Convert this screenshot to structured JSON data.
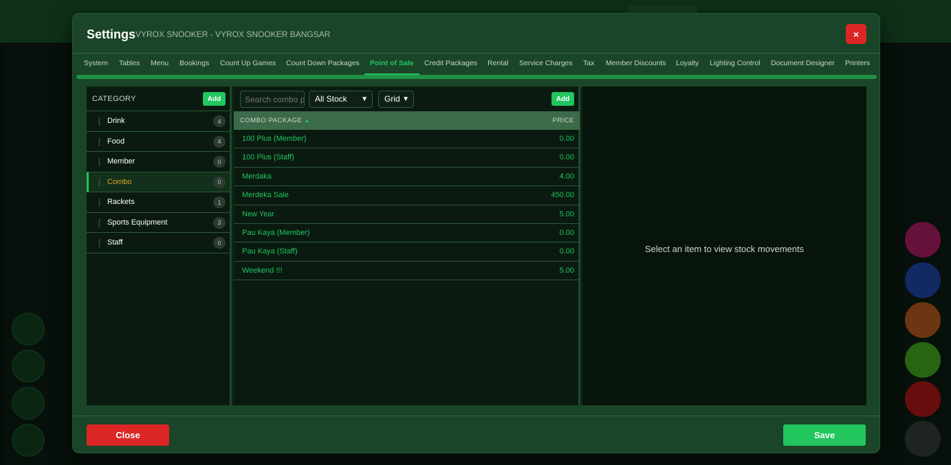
{
  "background": {
    "left_circles": 4,
    "right_circle_colors": [
      "#9d1a5c",
      "#1e3f9a",
      "#a8521c",
      "#3e9a1c",
      "#a01515",
      "#2f3a32"
    ]
  },
  "modal": {
    "title": "Settings",
    "subtitle": "VYROX SNOOKER - VYROX SNOOKER BANGSAR",
    "close_icon": "×"
  },
  "tabs": [
    {
      "label": "System"
    },
    {
      "label": "Tables"
    },
    {
      "label": "Menu"
    },
    {
      "label": "Bookings"
    },
    {
      "label": "Count Up Games"
    },
    {
      "label": "Count Down Packages"
    },
    {
      "label": "Point of Sale",
      "active": true
    },
    {
      "label": "Credit Packages"
    },
    {
      "label": "Rental"
    },
    {
      "label": "Service Charges"
    },
    {
      "label": "Tax"
    },
    {
      "label": "Member Discounts"
    },
    {
      "label": "Loyalty"
    },
    {
      "label": "Lighting Control"
    },
    {
      "label": "Document Designer"
    },
    {
      "label": "Printers"
    }
  ],
  "category": {
    "header": "CATEGORY",
    "add_label": "Add",
    "items": [
      {
        "name": "Drink",
        "count": "4"
      },
      {
        "name": "Food",
        "count": "4"
      },
      {
        "name": "Member",
        "count": "0"
      },
      {
        "name": "Combo",
        "count": "0",
        "active": true
      },
      {
        "name": "Rackets",
        "count": "1"
      },
      {
        "name": "Sports Equipment",
        "count": "3"
      },
      {
        "name": "Staff",
        "count": "0"
      }
    ]
  },
  "combo": {
    "search_placeholder": "Search combo p",
    "stock_filter": "All Stock",
    "view_mode": "Grid",
    "add_label": "Add",
    "columns": {
      "name": "COMBO PACKAGE",
      "price": "PRICE"
    },
    "sort_icon": "▲",
    "rows": [
      {
        "name": "100 Plus (Member)",
        "price": "0.00"
      },
      {
        "name": "100 Plus (Staff)",
        "price": "0.00"
      },
      {
        "name": "Merdaka",
        "price": "4.00"
      },
      {
        "name": "Merdeka Sale",
        "price": "450.00"
      },
      {
        "name": "New Year",
        "price": "5.00"
      },
      {
        "name": "Pau Kaya (Member)",
        "price": "0.00"
      },
      {
        "name": "Pau Kaya (Staff)",
        "price": "0.00"
      },
      {
        "name": "Weekend !!!",
        "price": "5.00"
      }
    ]
  },
  "stock": {
    "empty_message": "Select an item to view stock movements"
  },
  "footer": {
    "close_label": "Close",
    "save_label": "Save"
  },
  "colors": {
    "accent": "#22c55e",
    "danger": "#dc2626",
    "active_category": "#e0a526"
  }
}
